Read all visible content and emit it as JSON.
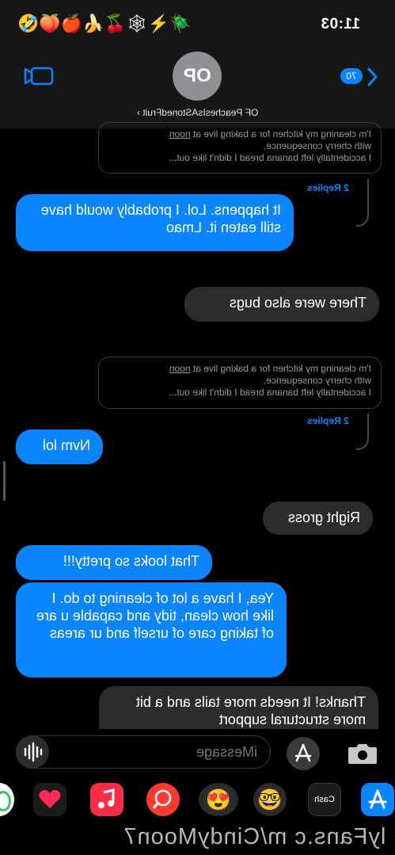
{
  "status_bar": {
    "time": "11:03",
    "emoji": "🤣🍑🍎🍌🍒🕸⚡🪲"
  },
  "header": {
    "avatar_initials": "OP",
    "contact_name": "OF PeachesIsAStonedFruit ›",
    "unread_count": "70"
  },
  "thread_preview": {
    "line1_prefix": "I'm cleaning my kitchen for a baking live at ",
    "line1_underlined": "noon",
    "line2": "with cherry consequence.",
    "line3": "I accidentally left banana bread I didn't like out..."
  },
  "messages": [
    {
      "kind": "replies",
      "text": "2 Replies"
    },
    {
      "kind": "blue",
      "text": "It happens. Lol. I probably would have still eaten it. Lmao"
    },
    {
      "kind": "gray",
      "text": "There were also bugs"
    },
    {
      "kind": "replies2",
      "text": "2 Replies"
    },
    {
      "kind": "blue",
      "text": "Nvm lol"
    },
    {
      "kind": "gray",
      "text": "Right gross"
    },
    {
      "kind": "blue",
      "text": "That looks so pretty!!!"
    },
    {
      "kind": "blue",
      "text": "Yea, I have a lot of cleaning to do. I like how clean, tidy and capable u are of taking care of urself and ur areas"
    },
    {
      "kind": "gray",
      "text": "Thanks! It needs more tails and a bit more structural support"
    }
  ],
  "input": {
    "placeholder": "iMessage"
  },
  "app_drawer": {
    "cash_label": "Cash",
    "icons": [
      "app-store-icon",
      "cash-app-icon",
      "memoji-icon",
      "memoji-stickers-icon",
      "web-images-icon",
      "music-icon",
      "heart-digital-touch-icon",
      "green-app-icon"
    ]
  },
  "watermark": "O lyFans.c m/CindyMoon7",
  "colors": {
    "accent": "#0a84ff",
    "gray_bubble": "#2c2c2e",
    "background": "#000000"
  }
}
